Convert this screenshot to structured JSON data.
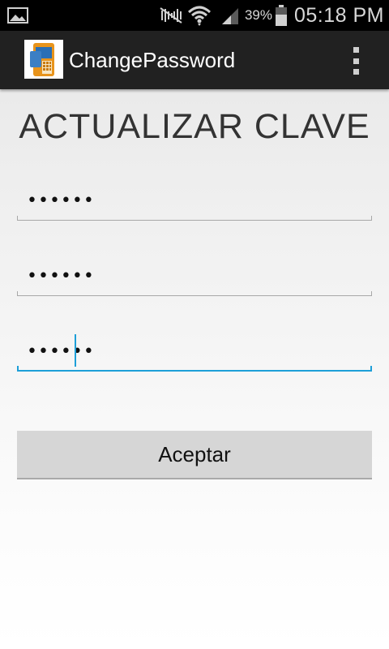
{
  "status_bar": {
    "battery_percent": "39%",
    "time": "05:18 PM",
    "icons": [
      "image-notification-icon",
      "silent-mode-icon",
      "wifi-icon",
      "signal-icon",
      "battery-icon"
    ]
  },
  "action_bar": {
    "title": "ChangePassword",
    "app_icon": "app-phone-icon",
    "menu_icon": "overflow-menu-icon"
  },
  "form": {
    "heading": "ACTUALIZAR CLAVE",
    "fields": [
      {
        "value": "••••••",
        "focused": false
      },
      {
        "value": "••••••",
        "focused": false
      },
      {
        "value": "••••••",
        "focused": true
      }
    ],
    "submit_label": "Aceptar"
  },
  "colors": {
    "accent": "#1d9fd8",
    "action_bar": "#212121",
    "status_bar": "#000000",
    "button": "#d6d6d6"
  }
}
